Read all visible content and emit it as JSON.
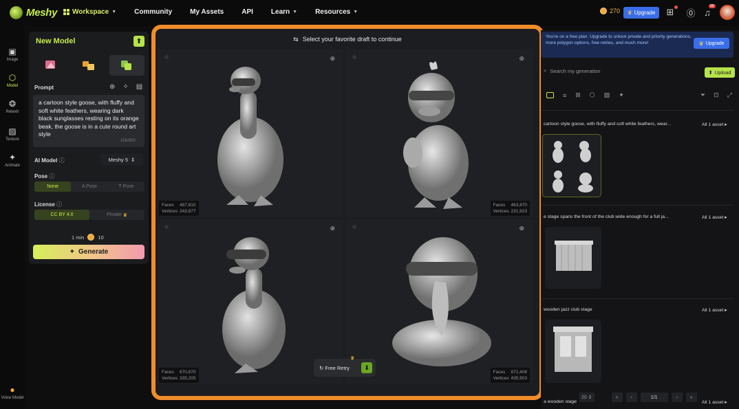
{
  "app": {
    "logo_text": "Meshy"
  },
  "nav": {
    "workspace": "Workspace",
    "community": "Community",
    "my_assets": "My Assets",
    "api": "API",
    "learn": "Learn",
    "resources": "Resources"
  },
  "header": {
    "credits": "270",
    "upgrade": "Upgrade",
    "notification_count": "90"
  },
  "rail": {
    "items": [
      {
        "label": "Image",
        "icon": "image-icon"
      },
      {
        "label": "Model",
        "icon": "cube-icon"
      },
      {
        "label": "Retexh",
        "icon": "retexture-icon"
      },
      {
        "label": "Texture",
        "icon": "texture-icon"
      },
      {
        "label": "Animate",
        "icon": "animate-icon"
      }
    ],
    "bottom_label": "Voice Model"
  },
  "left_panel": {
    "title": "New Model",
    "prompt_label": "Prompt",
    "prompt_text": "a cartoon style goose, with fluffy and soft white feathers, wearing dark black sunglasses resting on its orange beak, the goose is in a cute round art style",
    "prompt_count": "156/800",
    "ai_model_label": "AI Model",
    "ai_model_value": "Meshy 5",
    "pose_label": "Pose",
    "pose_options": [
      "None",
      "A Pose",
      "T Pose"
    ],
    "license_label": "License",
    "license_options": [
      "CC BY 4.0",
      "Private"
    ],
    "cost_time": "1 min",
    "cost_credits": "10",
    "generate_label": "Generate"
  },
  "center": {
    "header": "Select your favorite draft to continue",
    "drafts": [
      {
        "faces": "487,810",
        "vertices": "243,877"
      },
      {
        "faces": "463,870",
        "vertices": "231,923"
      },
      {
        "faces": "670,870",
        "vertices": "335,205"
      },
      {
        "faces": "872,408",
        "vertices": "435,903"
      }
    ],
    "faces_label": "Faces",
    "vertices_label": "Vertices",
    "retry_label": "Free Retry"
  },
  "right_panel": {
    "promo_text": "You're on a free plan. Upgrade to unlock private and priority generations, more polygon options, free retries, and much more!",
    "promo_button": "Upgrade",
    "search_placeholder": "Search my generation",
    "upload_label": "Upload",
    "generations": [
      {
        "title": "cartoon style goose, with fluffy and soft white feathers, wear...",
        "count": "All 1 asset"
      },
      {
        "title": "e stage spans the front of the club wide enough for a full ja...",
        "count": "All 1 asset"
      },
      {
        "title": "wooden jazz club stage",
        "count": "All 1 asset"
      },
      {
        "title": "a wooden stage",
        "count": "All 1 asset"
      }
    ],
    "per_page": "20",
    "page": "1/1"
  },
  "colors": {
    "accent": "#c8ec4a",
    "highlight_frame": "#f08c2a",
    "upgrade": "#3a6ee8"
  }
}
